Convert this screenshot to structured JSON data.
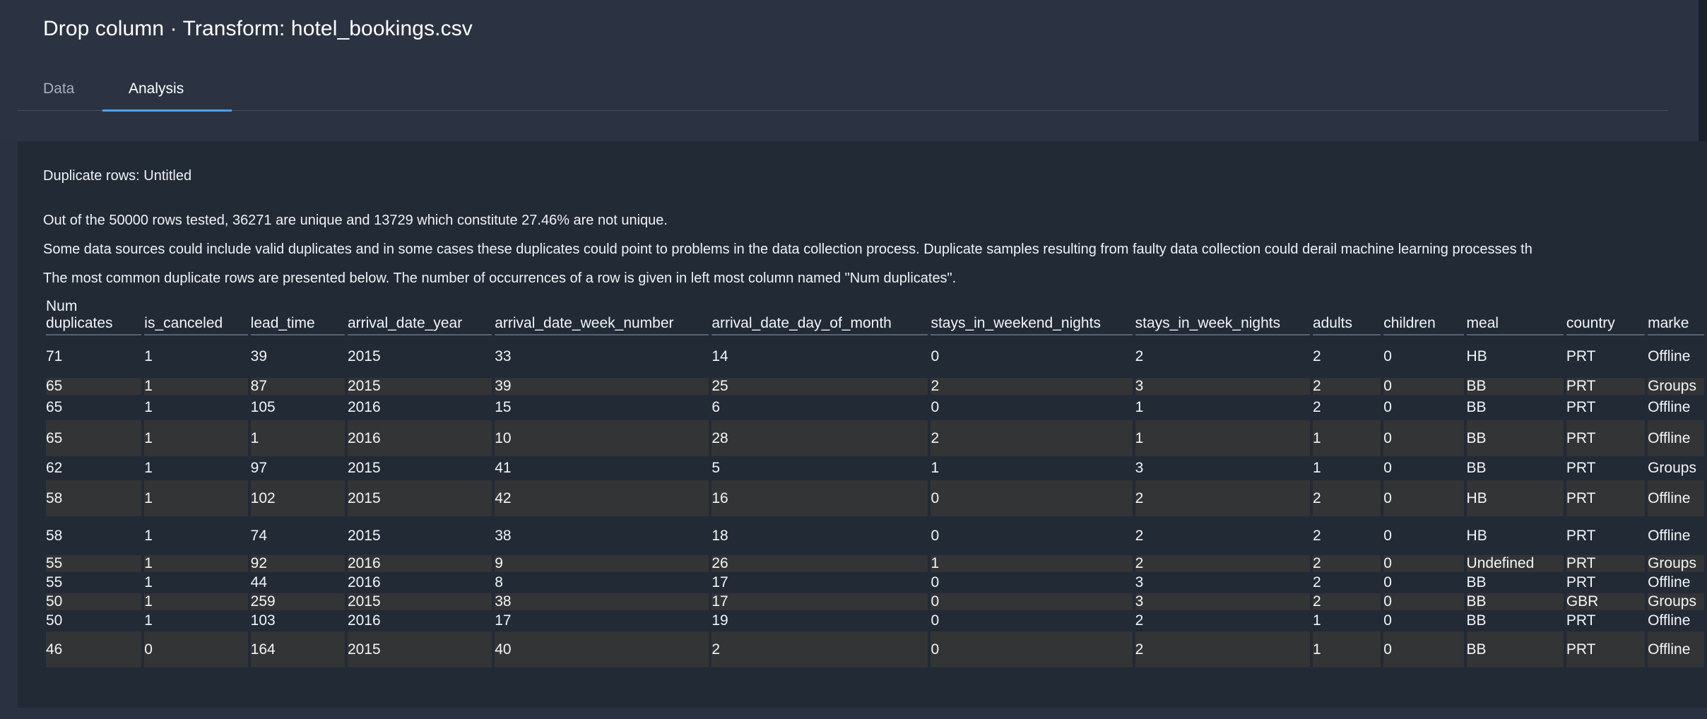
{
  "header": {
    "title": "Drop column · Transform: hotel_bookings.csv"
  },
  "tabs": [
    {
      "label": "Data"
    },
    {
      "label": "Analysis"
    }
  ],
  "analysis": {
    "section_title": "Duplicate rows: Untitled",
    "summary": "Out of the 50000 rows tested, 36271 are unique and 13729 which constitute 27.46% are not unique.",
    "explanation": "Some data sources could include valid duplicates and in some cases these duplicates could point to problems in the data collection process. Duplicate samples resulting from faulty data collection could derail machine learning processes th",
    "note": "The most common duplicate rows are presented below. The number of occurrences of a row is given in left most column named \"Num duplicates\".",
    "columns": [
      "Num duplicates",
      "is_canceled",
      "lead_time",
      "arrival_date_year",
      "arrival_date_week_number",
      "arrival_date_day_of_month",
      "stays_in_weekend_nights",
      "stays_in_week_nights",
      "adults",
      "children",
      "meal",
      "country",
      "marke"
    ],
    "rows": [
      [
        "71",
        "1",
        "39",
        "2015",
        "33",
        "14",
        "0",
        "2",
        "2",
        "0",
        "HB",
        "PRT",
        "Offline"
      ],
      [
        "65",
        "1",
        "87",
        "2015",
        "39",
        "25",
        "2",
        "3",
        "2",
        "0",
        "BB",
        "PRT",
        "Groups"
      ],
      [
        "65",
        "1",
        "105",
        "2016",
        "15",
        "6",
        "0",
        "1",
        "2",
        "0",
        "BB",
        "PRT",
        "Offline"
      ],
      [
        "65",
        "1",
        "1",
        "2016",
        "10",
        "28",
        "2",
        "1",
        "1",
        "0",
        "BB",
        "PRT",
        "Offline"
      ],
      [
        "62",
        "1",
        "97",
        "2015",
        "41",
        "5",
        "1",
        "3",
        "1",
        "0",
        "BB",
        "PRT",
        "Groups"
      ],
      [
        "58",
        "1",
        "102",
        "2015",
        "42",
        "16",
        "0",
        "2",
        "2",
        "0",
        "HB",
        "PRT",
        "Offline"
      ],
      [
        "58",
        "1",
        "74",
        "2015",
        "38",
        "18",
        "0",
        "2",
        "2",
        "0",
        "HB",
        "PRT",
        "Offline"
      ],
      [
        "55",
        "1",
        "92",
        "2016",
        "9",
        "26",
        "1",
        "2",
        "2",
        "0",
        "Undefined",
        "PRT",
        "Groups"
      ],
      [
        "55",
        "1",
        "44",
        "2016",
        "8",
        "17",
        "0",
        "3",
        "2",
        "0",
        "BB",
        "PRT",
        "Offline"
      ],
      [
        "50",
        "1",
        "259",
        "2015",
        "38",
        "17",
        "0",
        "3",
        "2",
        "0",
        "BB",
        "GBR",
        "Groups"
      ],
      [
        "50",
        "1",
        "103",
        "2016",
        "17",
        "19",
        "0",
        "2",
        "1",
        "0",
        "BB",
        "PRT",
        "Offline"
      ],
      [
        "46",
        "0",
        "164",
        "2015",
        "40",
        "2",
        "0",
        "2",
        "1",
        "0",
        "BB",
        "PRT",
        "Offline"
      ]
    ]
  }
}
